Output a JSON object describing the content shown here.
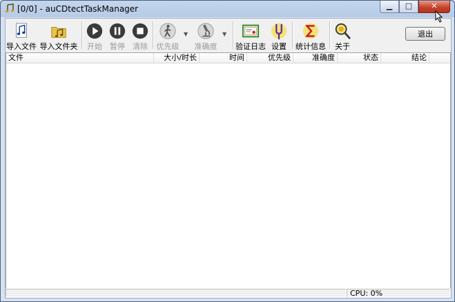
{
  "window": {
    "title": "[0/0] - auCDtectTaskManager",
    "minimize_glyph": "▁",
    "maximize_glyph": "□",
    "close_glyph": "✕"
  },
  "toolbar": {
    "import_file": "导入文件",
    "import_folder": "导入文件夹",
    "start": "开始",
    "pause": "暂停",
    "clear": "清除",
    "priority": "优先级",
    "accuracy": "准确度",
    "verify_log": "验证日志",
    "settings": "设置",
    "statistics": "统计信息",
    "about": "关于",
    "exit": "退出"
  },
  "columns": [
    "文件",
    "大小/时长",
    "时间",
    "优先级",
    "准确度",
    "状态",
    "结论"
  ],
  "statusbar": {
    "cpu": "CPU: 0%"
  },
  "colors": {
    "title_bar": "#c3d6ee",
    "close_button": "#c7432c",
    "list_background": "#ffffff"
  }
}
